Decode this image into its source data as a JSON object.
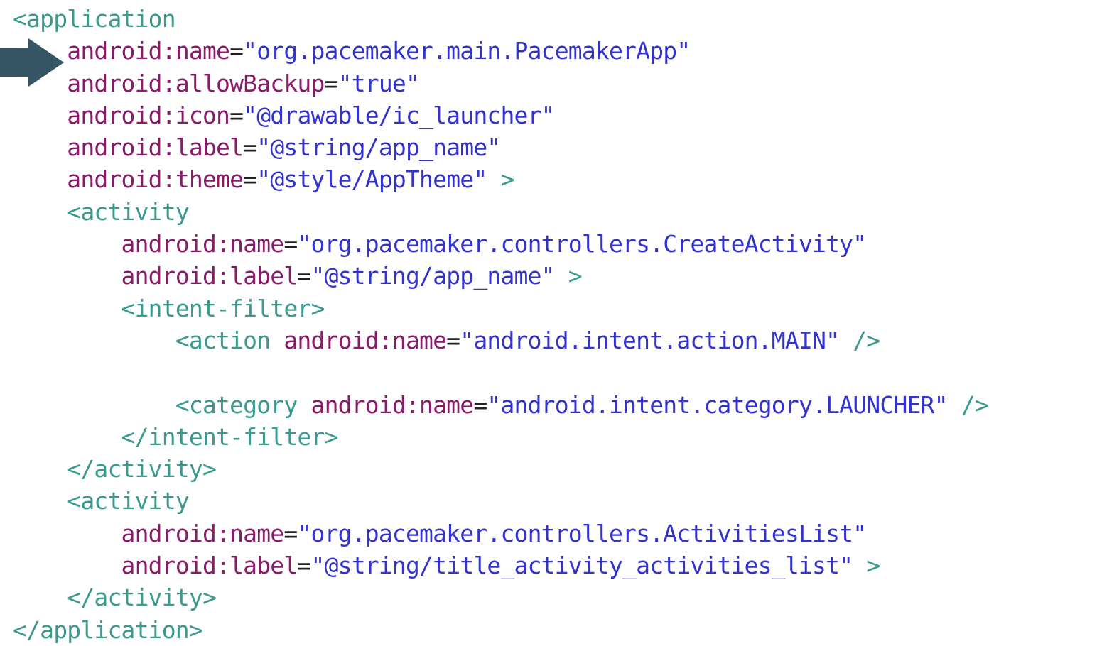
{
  "colors": {
    "tag": "#3a9a8f",
    "attribute": "#8a1a6a",
    "equals": "#222222",
    "string": "#3232d0",
    "arrow": "#355564"
  },
  "marker": {
    "icon": "arrow-right-icon"
  },
  "code_lines": [
    [
      {
        "t": "tag",
        "v": "<application"
      }
    ],
    [
      {
        "t": "sp",
        "v": "    "
      },
      {
        "t": "attr",
        "v": "android:name"
      },
      {
        "t": "eq",
        "v": "="
      },
      {
        "t": "str",
        "v": "\"org.pacemaker.main.PacemakerApp\""
      }
    ],
    [
      {
        "t": "sp",
        "v": "    "
      },
      {
        "t": "attr",
        "v": "android:allowBackup"
      },
      {
        "t": "eq",
        "v": "="
      },
      {
        "t": "str",
        "v": "\"true\""
      }
    ],
    [
      {
        "t": "sp",
        "v": "    "
      },
      {
        "t": "attr",
        "v": "android:icon"
      },
      {
        "t": "eq",
        "v": "="
      },
      {
        "t": "str",
        "v": "\"@drawable/ic_launcher\""
      }
    ],
    [
      {
        "t": "sp",
        "v": "    "
      },
      {
        "t": "attr",
        "v": "android:label"
      },
      {
        "t": "eq",
        "v": "="
      },
      {
        "t": "str",
        "v": "\"@string/app_name\""
      }
    ],
    [
      {
        "t": "sp",
        "v": "    "
      },
      {
        "t": "attr",
        "v": "android:theme"
      },
      {
        "t": "eq",
        "v": "="
      },
      {
        "t": "str",
        "v": "\"@style/AppTheme\""
      },
      {
        "t": "tag",
        "v": " >"
      }
    ],
    [
      {
        "t": "sp",
        "v": "    "
      },
      {
        "t": "tag",
        "v": "<activity"
      }
    ],
    [
      {
        "t": "sp",
        "v": "        "
      },
      {
        "t": "attr",
        "v": "android:name"
      },
      {
        "t": "eq",
        "v": "="
      },
      {
        "t": "str",
        "v": "\"org.pacemaker.controllers.CreateActivity\""
      }
    ],
    [
      {
        "t": "sp",
        "v": "        "
      },
      {
        "t": "attr",
        "v": "android:label"
      },
      {
        "t": "eq",
        "v": "="
      },
      {
        "t": "str",
        "v": "\"@string/app_name\""
      },
      {
        "t": "tag",
        "v": " >"
      }
    ],
    [
      {
        "t": "sp",
        "v": "        "
      },
      {
        "t": "tag",
        "v": "<intent-filter>"
      }
    ],
    [
      {
        "t": "sp",
        "v": "            "
      },
      {
        "t": "tag",
        "v": "<action "
      },
      {
        "t": "attr",
        "v": "android:name"
      },
      {
        "t": "eq",
        "v": "="
      },
      {
        "t": "str",
        "v": "\"android.intent.action.MAIN\""
      },
      {
        "t": "tag",
        "v": " />"
      }
    ],
    [],
    [
      {
        "t": "sp",
        "v": "            "
      },
      {
        "t": "tag",
        "v": "<category "
      },
      {
        "t": "attr",
        "v": "android:name"
      },
      {
        "t": "eq",
        "v": "="
      },
      {
        "t": "str",
        "v": "\"android.intent.category.LAUNCHER\""
      },
      {
        "t": "tag",
        "v": " />"
      }
    ],
    [
      {
        "t": "sp",
        "v": "        "
      },
      {
        "t": "tag",
        "v": "</intent-filter>"
      }
    ],
    [
      {
        "t": "sp",
        "v": "    "
      },
      {
        "t": "tag",
        "v": "</activity>"
      }
    ],
    [
      {
        "t": "sp",
        "v": "    "
      },
      {
        "t": "tag",
        "v": "<activity"
      }
    ],
    [
      {
        "t": "sp",
        "v": "        "
      },
      {
        "t": "attr",
        "v": "android:name"
      },
      {
        "t": "eq",
        "v": "="
      },
      {
        "t": "str",
        "v": "\"org.pacemaker.controllers.ActivitiesList\""
      }
    ],
    [
      {
        "t": "sp",
        "v": "        "
      },
      {
        "t": "attr",
        "v": "android:label"
      },
      {
        "t": "eq",
        "v": "="
      },
      {
        "t": "str",
        "v": "\"@string/title_activity_activities_list\""
      },
      {
        "t": "tag",
        "v": " >"
      }
    ],
    [
      {
        "t": "sp",
        "v": "    "
      },
      {
        "t": "tag",
        "v": "</activity>"
      }
    ],
    [
      {
        "t": "tag",
        "v": "</application>"
      }
    ]
  ]
}
